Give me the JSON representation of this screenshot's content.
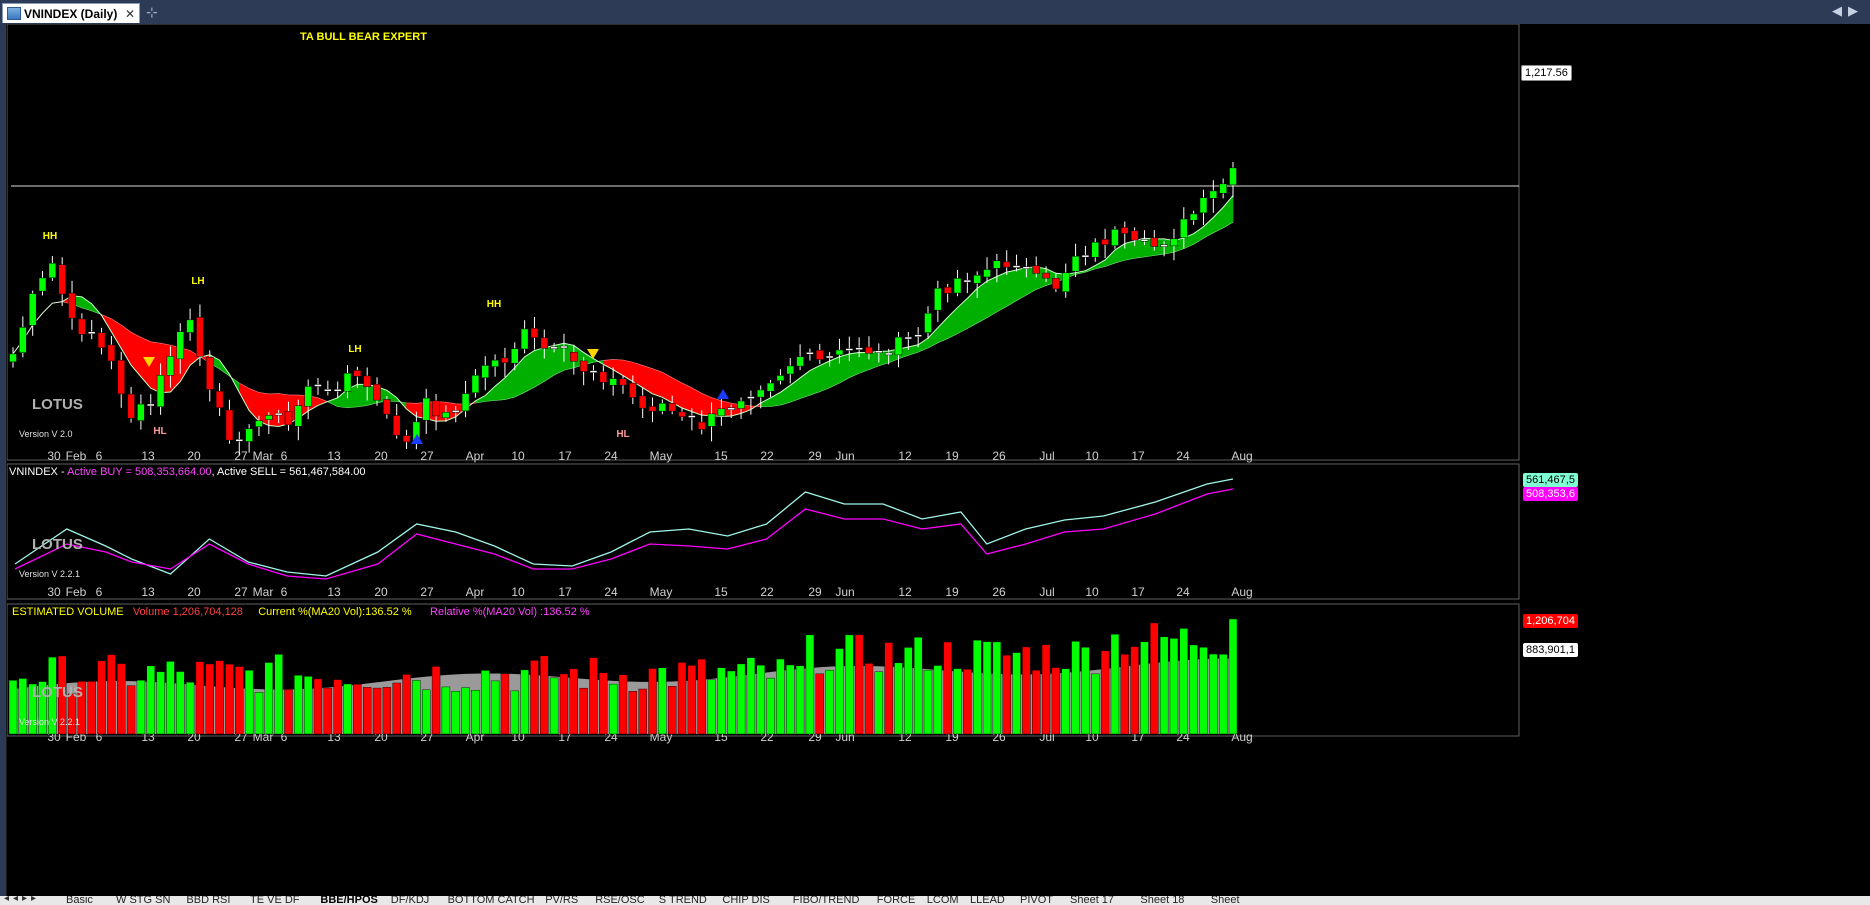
{
  "window": {
    "tab_title": "VNINDEX (Daily)",
    "close": "✕",
    "pin": "⊹",
    "nav_left": "◀",
    "nav_right": "▶"
  },
  "price_pane": {
    "title": "TA BULL BEAR EXPERT",
    "watermark": "LOTUS",
    "version": "Version V 2.0",
    "last_price": "1,217.56",
    "pivot_labels": [
      {
        "text": "HH",
        "color": "#ffff00"
      },
      {
        "text": "HL",
        "color": "#ff9999"
      },
      {
        "text": "LH",
        "color": "#ffff00"
      },
      {
        "text": "LH",
        "color": "#ffff00"
      },
      {
        "text": "HH",
        "color": "#ffff00"
      },
      {
        "text": "HL",
        "color": "#ff9999"
      }
    ]
  },
  "x_axis": {
    "labels": [
      "30",
      "Feb",
      "6",
      "13",
      "20",
      "27",
      "Mar",
      "6",
      "13",
      "20",
      "27",
      "Apr",
      "10",
      "17",
      "24",
      "May",
      "15",
      "22",
      "29",
      "Jun",
      "12",
      "19",
      "26",
      "Jul",
      "10",
      "17",
      "24",
      "Aug"
    ]
  },
  "flow_pane": {
    "legend_name": "VNINDEX - ",
    "legend_buy": "Active BUY = 508,353,664.00",
    "legend_sep": ", ",
    "legend_sell": "Active SELL = 561,467,584.00",
    "watermark": "LOTUS",
    "version": "Version V 2.2.1",
    "sell_tag": "561,467,5",
    "buy_tag": "508,353,6",
    "colors": {
      "buy": "#ff00ff",
      "sell": "#7fffd4"
    }
  },
  "volume_pane": {
    "title": "ESTIMATED VOLUME",
    "volume": "Volume 1,206,704,128",
    "current": "Current %(MA20 Vol):136.52 %",
    "relative": "Relative %(MA20 Vol) :136.52 %",
    "watermark": "LOTUS",
    "version": "Version V 2.2.1",
    "vol_tag": "1,206,704",
    "ma_tag": "883,901,1"
  },
  "sheets": [
    "Basic",
    "W STG SN",
    "BBD RSI",
    "TE VE DF",
    "BBE/HPOS",
    "DF/KDJ",
    "BOTTOM CATCH",
    "PV/RS",
    "RSE/OSC",
    "S TREND",
    "CHIP DIS",
    "FIBO/TREND",
    "FORCE",
    "LCOM",
    "LLEAD",
    "PIVOT",
    "Sheet 17",
    "Sheet 18",
    "Sheet"
  ],
  "chart_data": {
    "type": "candlestick",
    "title": "TA BULL BEAR EXPERT",
    "symbol": "VNINDEX (Daily)",
    "last_close": 1217.56,
    "x_labels": [
      "30",
      "Feb",
      "6",
      "13",
      "20",
      "27",
      "Mar",
      "6",
      "13",
      "20",
      "27",
      "Apr",
      "10",
      "17",
      "24",
      "May",
      "15",
      "22",
      "29",
      "Jun",
      "12",
      "19",
      "26",
      "Jul",
      "10",
      "17",
      "24",
      "Aug"
    ],
    "series": [
      {
        "name": "Active BUY",
        "last": 508353664.0
      },
      {
        "name": "Active SELL",
        "last": 561467584.0
      },
      {
        "name": "Volume",
        "last": 1206704128
      },
      {
        "name": "Current %(MA20 Vol)",
        "last": 136.52
      },
      {
        "name": "Relative %(MA20 Vol)",
        "last": 136.52
      }
    ]
  }
}
